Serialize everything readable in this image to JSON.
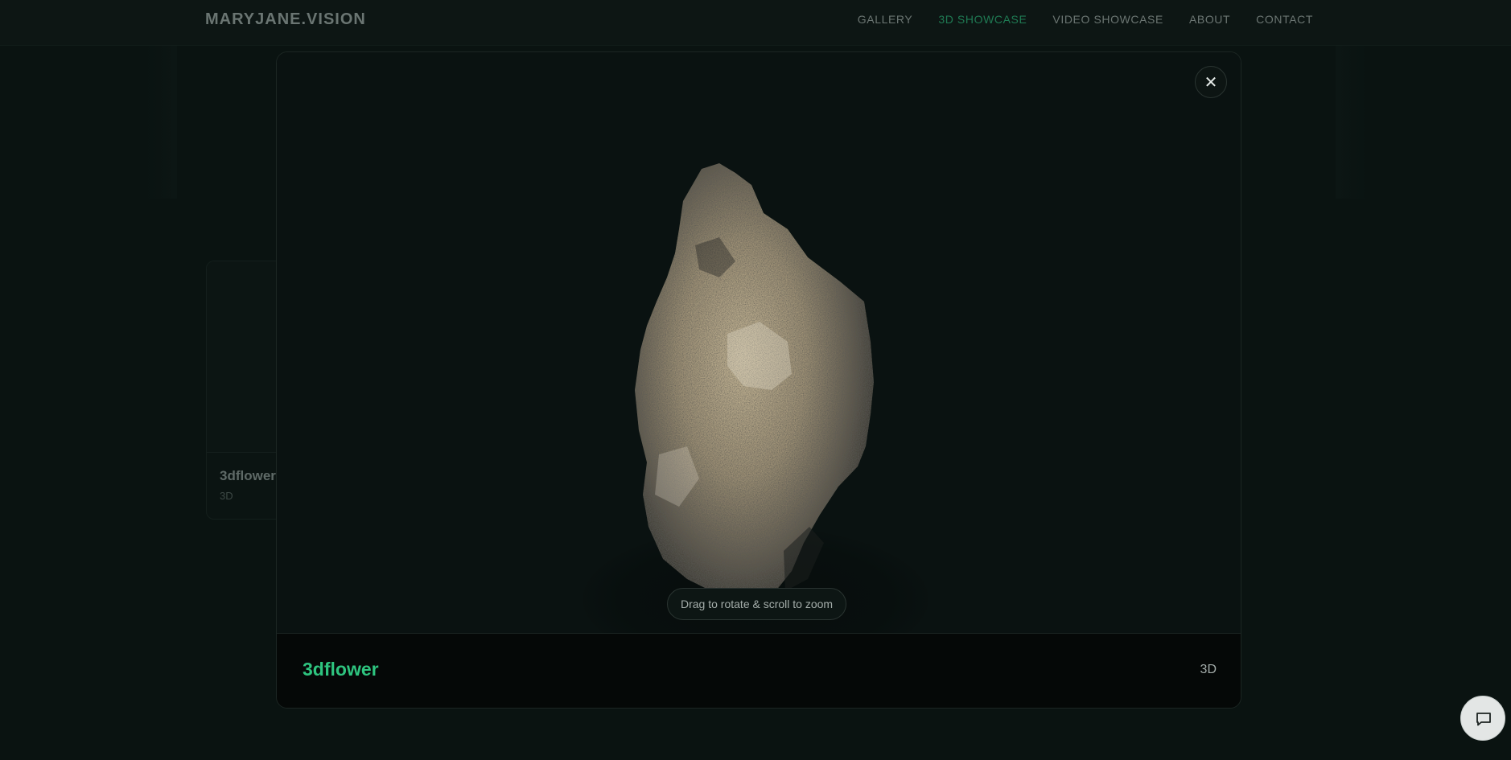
{
  "brand": {
    "name": "MARYJANE.VISION"
  },
  "nav": {
    "items": [
      {
        "label": "GALLERY"
      },
      {
        "label": "3D SHOWCASE",
        "active": true
      },
      {
        "label": "VIDEO SHOWCASE"
      },
      {
        "label": "ABOUT"
      },
      {
        "label": "CONTACT"
      }
    ]
  },
  "background_card": {
    "title": "3dflower",
    "type": "3D"
  },
  "modal": {
    "close_icon": "close-icon",
    "hint": "Drag to rotate & scroll to zoom",
    "title": "3dflower",
    "type": "3D"
  },
  "chat": {
    "icon": "chat-bubble-icon"
  },
  "colors": {
    "accent": "#2ec47f",
    "nav_active": "#1f7a53",
    "background": "#0a1311"
  }
}
